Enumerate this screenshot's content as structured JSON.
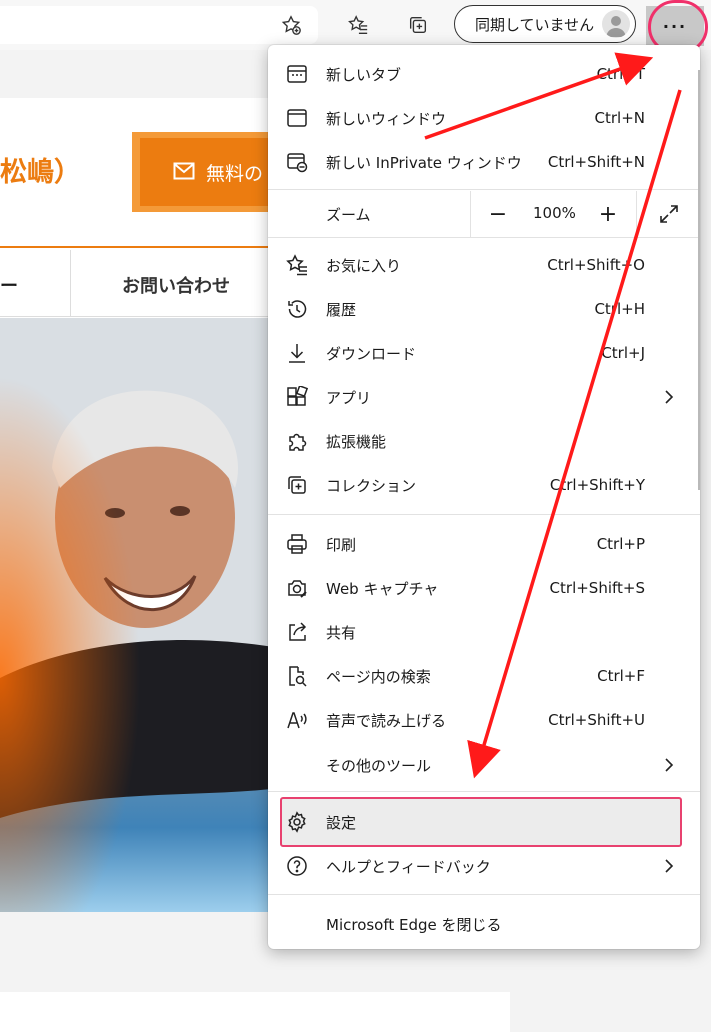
{
  "toolbar": {
    "sync_label": "同期していません",
    "more_label": "···",
    "icons": [
      "star-add-icon",
      "favorites-icon",
      "collections-icon",
      "avatar-icon",
      "more-icon"
    ]
  },
  "page": {
    "site_title": "松嶋）",
    "cta_label": "無料の",
    "nav_dash": "ー",
    "nav_contact": "お問い合わせ"
  },
  "menu": {
    "new_tab": {
      "label": "新しいタブ",
      "shortcut": "Ctrl+T"
    },
    "new_window": {
      "label": "新しいウィンドウ",
      "shortcut": "Ctrl+N"
    },
    "new_inprivate": {
      "label": "新しい InPrivate ウィンドウ",
      "shortcut": "Ctrl+Shift+N"
    },
    "zoom": {
      "label": "ズーム",
      "value": "100%",
      "minus": "−",
      "plus": "+"
    },
    "favorites": {
      "label": "お気に入り",
      "shortcut": "Ctrl+Shift+O"
    },
    "history": {
      "label": "履歴",
      "shortcut": "Ctrl+H"
    },
    "downloads": {
      "label": "ダウンロード",
      "shortcut": "Ctrl+J"
    },
    "apps": {
      "label": "アプリ"
    },
    "extensions": {
      "label": "拡張機能"
    },
    "collections": {
      "label": "コレクション",
      "shortcut": "Ctrl+Shift+Y"
    },
    "print": {
      "label": "印刷",
      "shortcut": "Ctrl+P"
    },
    "web_capture": {
      "label": "Web キャプチャ",
      "shortcut": "Ctrl+Shift+S"
    },
    "share": {
      "label": "共有"
    },
    "find": {
      "label": "ページ内の検索",
      "shortcut": "Ctrl+F"
    },
    "read_aloud": {
      "label": "音声で読み上げる",
      "shortcut": "Ctrl+Shift+U"
    },
    "more_tools": {
      "label": "その他のツール"
    },
    "settings": {
      "label": "設定"
    },
    "help": {
      "label": "ヘルプとフィードバック"
    },
    "close_edge": {
      "label": "Microsoft Edge を閉じる"
    }
  },
  "colors": {
    "accent_orange": "#ec7c10",
    "annotation_red": "#ff1a1a",
    "highlight_pink": "#e8416f"
  }
}
